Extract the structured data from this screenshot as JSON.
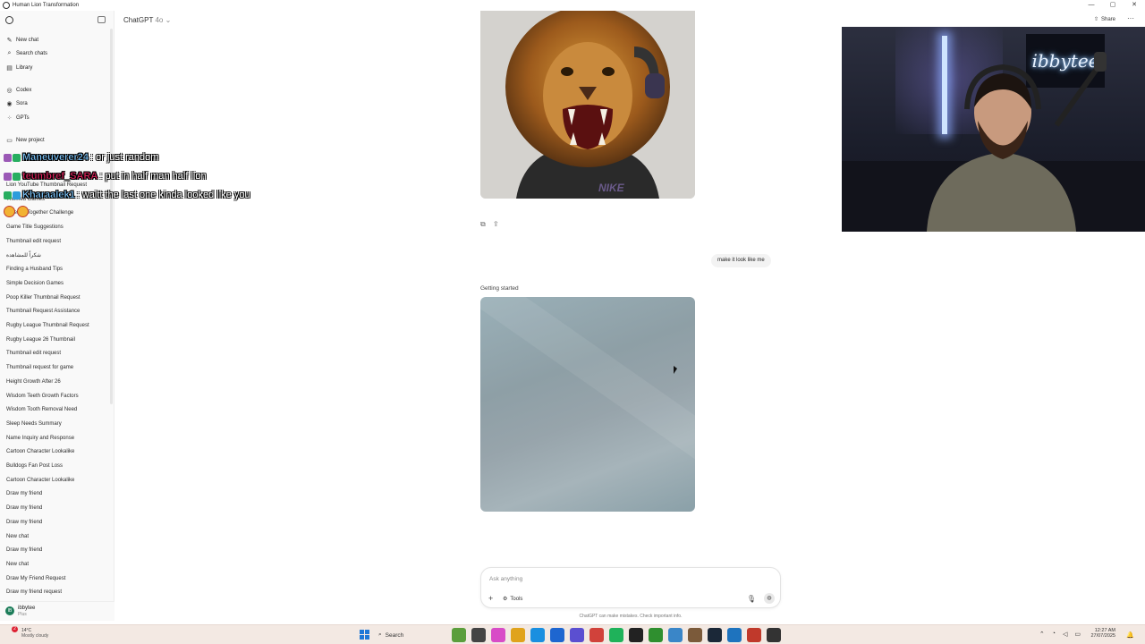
{
  "window": {
    "title": "Human Lion Transformation",
    "controls": [
      "—",
      "▢",
      "✕"
    ]
  },
  "header": {
    "model": "ChatGPT",
    "model_version": "4o",
    "share_label": "Share",
    "more_label": "···"
  },
  "sidebar": {
    "nav": [
      {
        "label": "New chat",
        "icon": "new-chat-icon",
        "glyph": "✎"
      },
      {
        "label": "Search chats",
        "icon": "search-icon",
        "glyph": "⌕"
      },
      {
        "label": "Library",
        "icon": "library-icon",
        "glyph": "▤"
      },
      {
        "label": "Codex",
        "icon": "codex-icon",
        "glyph": "◎"
      },
      {
        "label": "Sora",
        "icon": "sora-icon",
        "glyph": "◉"
      },
      {
        "label": "GPTs",
        "icon": "gpts-icon",
        "glyph": "⁘"
      },
      {
        "label": "New project",
        "icon": "folder-icon",
        "glyph": "▭"
      }
    ],
    "chats": [
      "Lion YouTube Thumbnail Request",
      "Themed Games",
      "Disease Together Challenge",
      "Game Title Suggestions",
      "Thumbnail edit request",
      "شكراً للمشاهدة",
      "Finding a Husband Tips",
      "Simple Decision Games",
      "Poop Killer Thumbnail Request",
      "Thumbnail Request Assistance",
      "Rugby League Thumbnail Request",
      "Rugby League 26 Thumbnail",
      "Thumbnail edit request",
      "Thumbnail request for game",
      "Height Growth After 26",
      "Wisdom Teeth Growth Factors",
      "Wisdom Tooth Removal Need",
      "Sleep Needs Summary",
      "Name Inquiry and Response",
      "Cartoon Character Lookalike",
      "Bulldogs Fan Post Loss",
      "Cartoon Character Lookalike",
      "Draw my friend",
      "Draw my friend",
      "Draw my friend",
      "New chat",
      "Draw my friend",
      "New chat",
      "Draw My Friend Request",
      "Draw my friend request"
    ],
    "user": {
      "initials": "IB",
      "name": "ibbytee",
      "plan": "Plus"
    }
  },
  "conversation": {
    "user_message": "make it look like me",
    "status": "Getting started",
    "action_icons": [
      "copy-icon",
      "share-icon"
    ]
  },
  "composer": {
    "placeholder": "Ask anything",
    "plus": "+",
    "tools_label": "Tools",
    "disclaimer": "ChatGPT can make mistakes. Check important info."
  },
  "image": {
    "shirt_text": "NIKE"
  },
  "webcam": {
    "sign_text": "ibbytee"
  },
  "stream_chat": [
    {
      "name": "Maneuverer24",
      "message": ": or just random",
      "color": "#7ec8ff",
      "badges": [
        "#9b59b6",
        "#27ae60"
      ]
    },
    {
      "name": "teumbref_SARA",
      "message": ": put in half man half lion",
      "color": "#e0245e",
      "badges": [
        "#9b59b6",
        "#27ae60"
      ]
    },
    {
      "name": "Kharaalek1",
      "message": ": waitt the last one kinda looked like you",
      "color": "#7ec8ff",
      "badges": [
        "#27ae60",
        "#2d9cdb"
      ]
    }
  ],
  "taskbar": {
    "weather": {
      "badge": "2",
      "temp": "14°C",
      "condition": "Mostly cloudy"
    },
    "search_label": "Search",
    "apps": [
      "#5b9e3c",
      "#444444",
      "#d84cc7",
      "#e0a31c",
      "#1a8fe0",
      "#1e66d0",
      "#5b4fd1",
      "#d1423b",
      "#1fb25a",
      "#222222",
      "#2f8f2f",
      "#3a86c8",
      "#7b5a3a",
      "#1b2838",
      "#1e73be",
      "#c0392b",
      "#333333"
    ],
    "time": "12:27 AM",
    "date": "27/07/2025"
  }
}
